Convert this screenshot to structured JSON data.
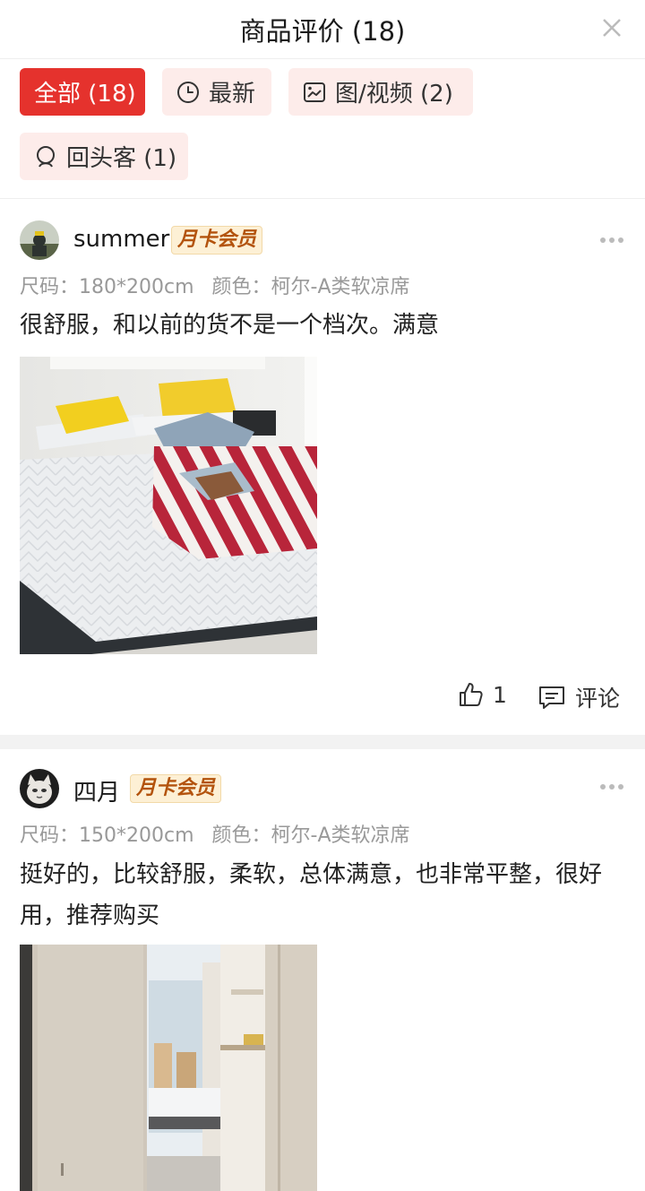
{
  "header": {
    "title": "商品评价 (18)",
    "close_icon": "close-icon"
  },
  "filters": [
    {
      "label": "全部 (18)",
      "active": true,
      "icon": ""
    },
    {
      "label": "最新",
      "active": false,
      "icon": "clock-icon"
    },
    {
      "label": "图/视频 (2)",
      "active": false,
      "icon": "image-icon"
    },
    {
      "label": "回头客 (1)",
      "active": false,
      "icon": "returning-customer-icon"
    }
  ],
  "reviews": [
    {
      "user": "summer",
      "badge": "月卡会员",
      "size_label": "尺码：",
      "size": "180*200cm",
      "color_label": "颜色：",
      "color": "柯尔-A类软凉席",
      "content": "很舒服，和以前的货不是一个档次。满意",
      "likes": "1",
      "comment_label": "评论"
    },
    {
      "user": "四月",
      "badge": "月卡会员",
      "size_label": "尺码：",
      "size": "150*200cm",
      "color_label": "颜色：",
      "color": "柯尔-A类软凉席",
      "content": "挺好的，比较舒服，柔软，总体满意，也非常平整，很好用，推荐购买"
    }
  ],
  "colors": {
    "accent": "#e5322d",
    "chip_bg": "#fdecea",
    "badge_bg": "#fdf0d5",
    "badge_text": "#b3530d"
  }
}
